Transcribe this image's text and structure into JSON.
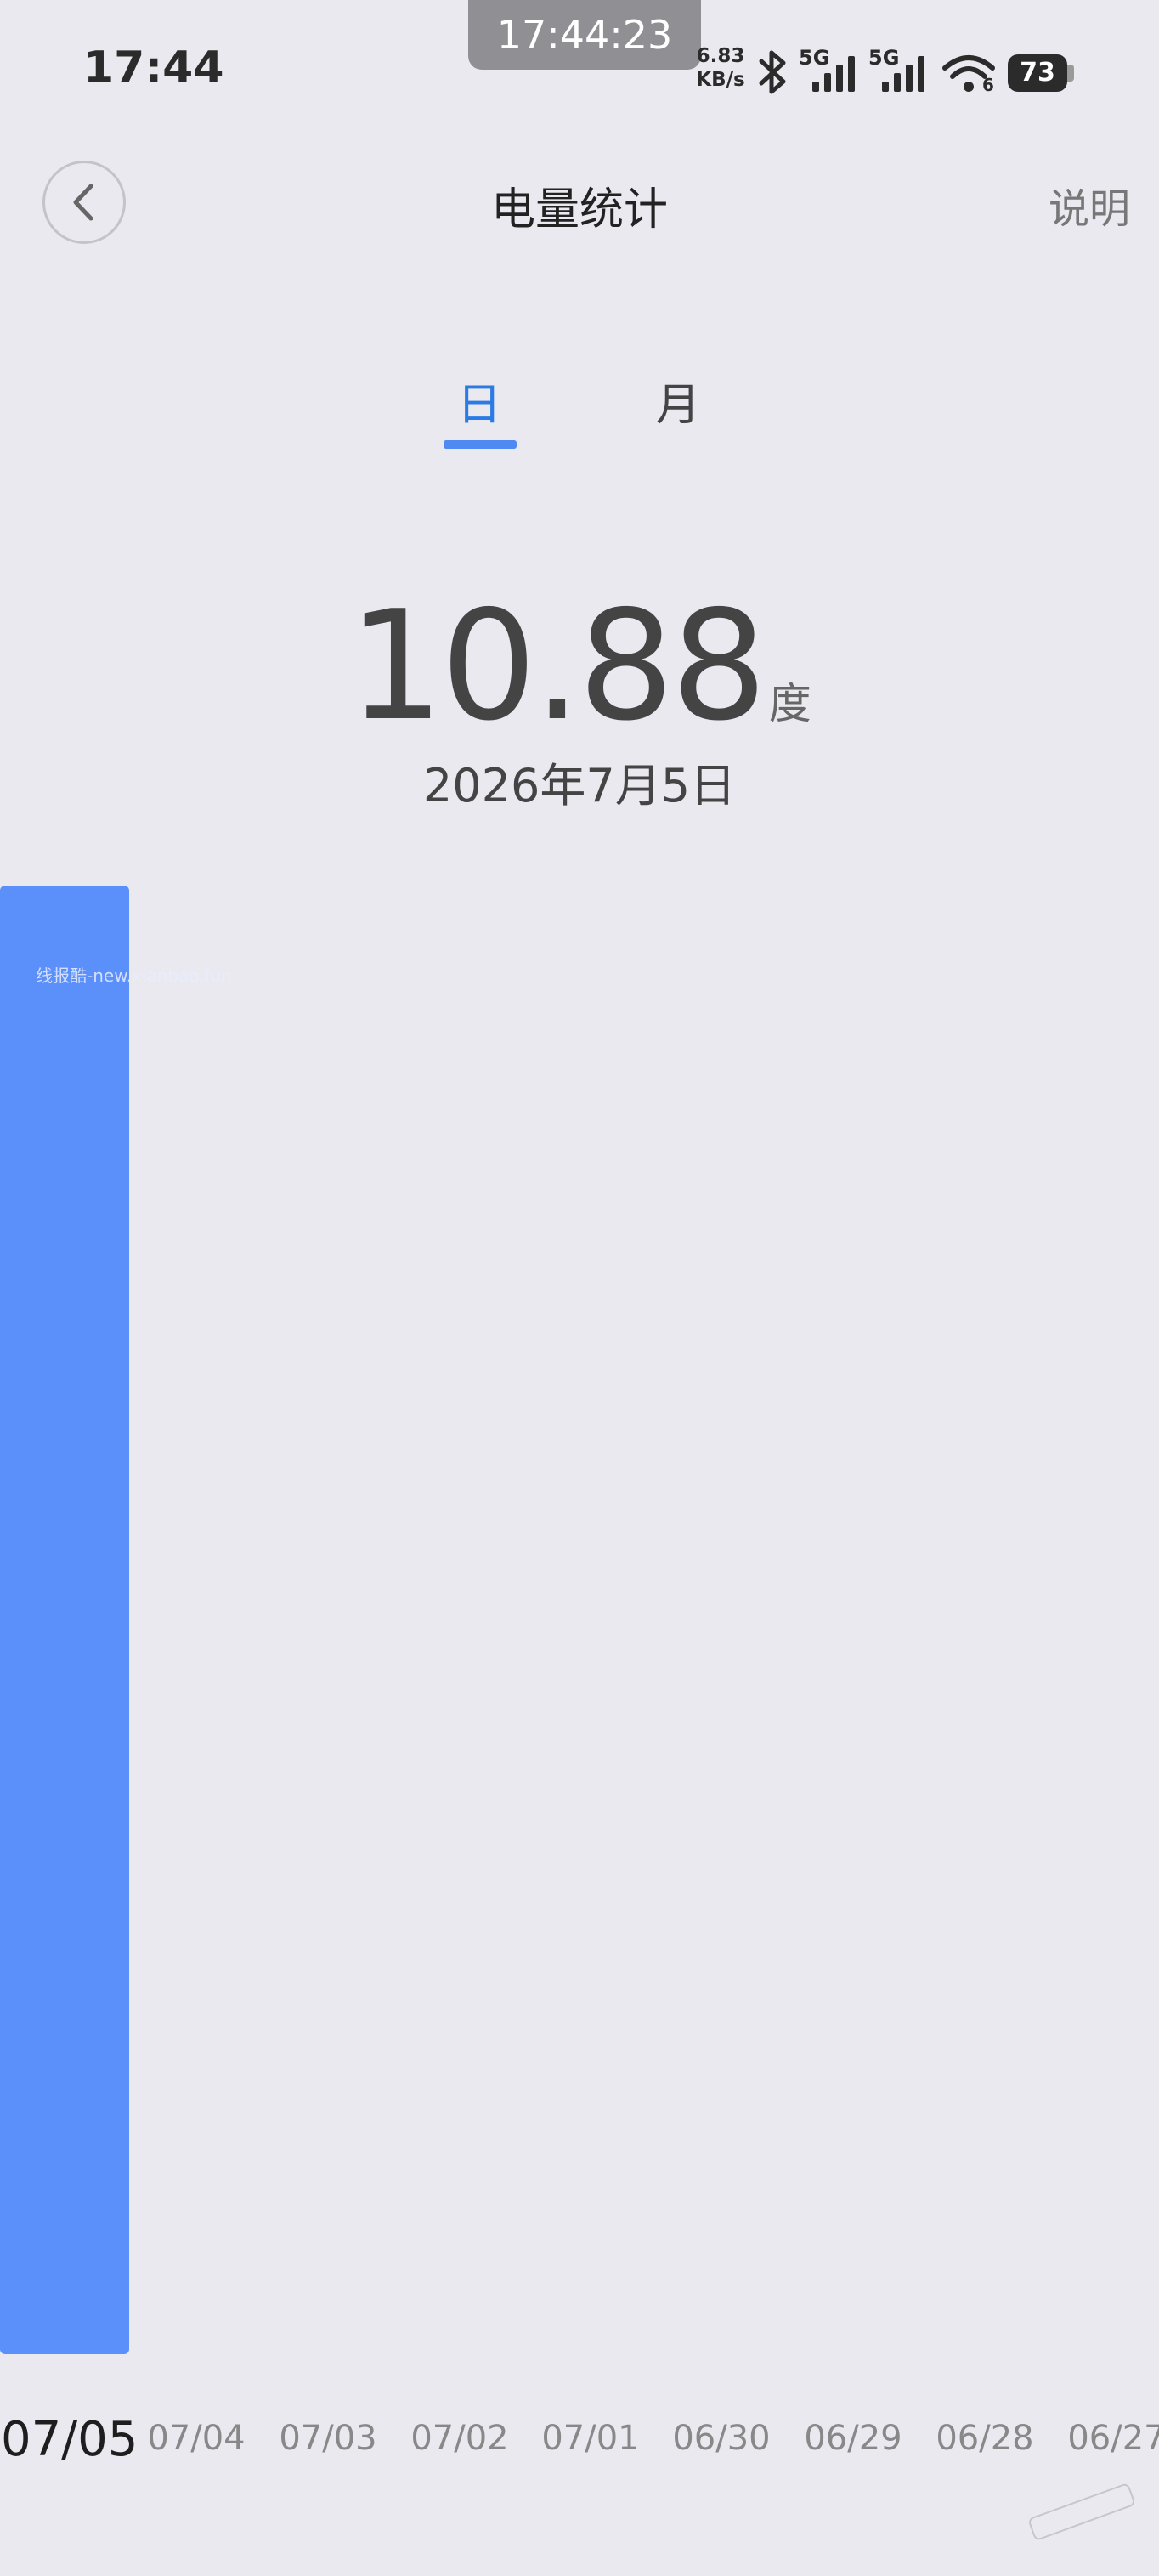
{
  "status_bar": {
    "time": "17:44",
    "recording_time": "17:44:23",
    "net_speed_value": "6.83",
    "net_speed_unit": "KB/s",
    "sim1": "5G",
    "sim2": "5G",
    "wifi_label": "6",
    "battery": "73",
    "icons": [
      "bluetooth-icon",
      "signal-icon",
      "wifi-icon",
      "battery-icon"
    ]
  },
  "header": {
    "title": "电量统计",
    "help": "说明",
    "back_icon": "chevron-left-icon"
  },
  "tabs": [
    {
      "label": "日",
      "selected": true
    },
    {
      "label": "月",
      "selected": false
    }
  ],
  "summary": {
    "value": "10.88",
    "unit": "度",
    "date": "2026年7月5日"
  },
  "watermark": "线报酷-new.xianbao.fun",
  "colors": {
    "accent": "#2a7be4",
    "bar": "#5b8ffa",
    "background": "#e9e9ef"
  },
  "chart_data": {
    "type": "bar",
    "categories": [
      "07/05",
      "07/04",
      "07/03",
      "07/02",
      "07/01",
      "06/30",
      "06/29",
      "06/28",
      "06/27"
    ],
    "values": [
      10.88,
      0,
      0,
      0,
      0,
      0,
      0,
      0,
      0
    ],
    "selected_index": 0,
    "ylim": [
      0,
      10.88
    ]
  }
}
